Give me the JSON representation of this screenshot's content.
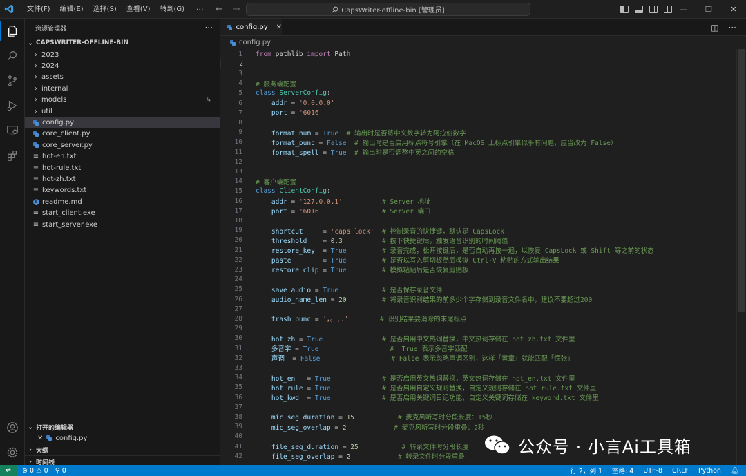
{
  "titlebar": {
    "menus": [
      "文件(F)",
      "编辑(E)",
      "选择(S)",
      "查看(V)",
      "转到(G)"
    ],
    "more": "···",
    "search_text": "CapsWriter-offline-bin [管理员]"
  },
  "sidebar": {
    "title": "资源管理器",
    "more": "···",
    "folder": "CAPSWRITER-OFFLINE-BIN",
    "items": [
      {
        "label": "2023",
        "kind": "folder"
      },
      {
        "label": "2024",
        "kind": "folder"
      },
      {
        "label": "assets",
        "kind": "folder"
      },
      {
        "label": "internal",
        "kind": "folder"
      },
      {
        "label": "models",
        "kind": "folder"
      },
      {
        "label": "util",
        "kind": "folder"
      },
      {
        "label": "config.py",
        "kind": "py"
      },
      {
        "label": "core_client.py",
        "kind": "py"
      },
      {
        "label": "core_server.py",
        "kind": "py"
      },
      {
        "label": "hot-en.txt",
        "kind": "txt"
      },
      {
        "label": "hot-rule.txt",
        "kind": "txt"
      },
      {
        "label": "hot-zh.txt",
        "kind": "txt"
      },
      {
        "label": "keywords.txt",
        "kind": "txt"
      },
      {
        "label": "readme.md",
        "kind": "md"
      },
      {
        "label": "start_client.exe",
        "kind": "txt"
      },
      {
        "label": "start_server.exe",
        "kind": "txt"
      }
    ],
    "open_editors_title": "打开的编辑器",
    "open_editors": [
      "config.py"
    ],
    "outline_title": "大纲",
    "timeline_title": "时间线"
  },
  "editor": {
    "tab_label": "config.py",
    "breadcrumb": "config.py",
    "current_line": 2
  },
  "code_lines": [
    [
      [
        "kw",
        "from"
      ],
      [
        "plain",
        " pathlib "
      ],
      [
        "kw",
        "import"
      ],
      [
        "plain",
        " Path"
      ]
    ],
    [],
    [],
    [
      [
        "cm",
        "# 服务端配置"
      ]
    ],
    [
      [
        "kw2",
        "class"
      ],
      [
        "plain",
        " "
      ],
      [
        "cls",
        "ServerConfig"
      ],
      [
        "plain",
        ":"
      ]
    ],
    [
      [
        "plain",
        "    "
      ],
      [
        "id",
        "addr"
      ],
      [
        "plain",
        " = "
      ],
      [
        "str",
        "'0.0.0.0'"
      ]
    ],
    [
      [
        "plain",
        "    "
      ],
      [
        "id",
        "port"
      ],
      [
        "plain",
        " = "
      ],
      [
        "str",
        "'6016'"
      ]
    ],
    [],
    [
      [
        "plain",
        "    "
      ],
      [
        "id",
        "format_num"
      ],
      [
        "plain",
        " = "
      ],
      [
        "kw2",
        "True"
      ],
      [
        "plain",
        "  "
      ],
      [
        "cm",
        "# 输出时是否将中文数字转为阿拉伯数字"
      ]
    ],
    [
      [
        "plain",
        "    "
      ],
      [
        "id",
        "format_punc"
      ],
      [
        "plain",
        " = "
      ],
      [
        "kw2",
        "False"
      ],
      [
        "plain",
        "  "
      ],
      [
        "cm",
        "# 输出时是否启用标点符号引擎（在 MacOS 上标点引擎似乎有问题，应当改为 False）"
      ]
    ],
    [
      [
        "plain",
        "    "
      ],
      [
        "id",
        "format_spell"
      ],
      [
        "plain",
        " = "
      ],
      [
        "kw2",
        "True"
      ],
      [
        "plain",
        "  "
      ],
      [
        "cm",
        "# 输出时是否调整中英之间的空格"
      ]
    ],
    [],
    [],
    [
      [
        "cm",
        "# 客户端配置"
      ]
    ],
    [
      [
        "kw2",
        "class"
      ],
      [
        "plain",
        " "
      ],
      [
        "cls",
        "ClientConfig"
      ],
      [
        "plain",
        ":"
      ]
    ],
    [
      [
        "plain",
        "    "
      ],
      [
        "id",
        "addr"
      ],
      [
        "plain",
        " = "
      ],
      [
        "str",
        "'127.0.0.1'"
      ],
      [
        "plain",
        "          "
      ],
      [
        "cm",
        "# Server 地址"
      ]
    ],
    [
      [
        "plain",
        "    "
      ],
      [
        "id",
        "port"
      ],
      [
        "plain",
        " = "
      ],
      [
        "str",
        "'6016'"
      ],
      [
        "plain",
        "               "
      ],
      [
        "cm",
        "# Server 端口"
      ]
    ],
    [],
    [
      [
        "plain",
        "    "
      ],
      [
        "id",
        "shortcut"
      ],
      [
        "plain",
        "     = "
      ],
      [
        "str",
        "'caps lock'"
      ],
      [
        "plain",
        "  "
      ],
      [
        "cm",
        "# 控制录音的快捷键，默认是 CapsLock"
      ]
    ],
    [
      [
        "plain",
        "    "
      ],
      [
        "id",
        "threshold"
      ],
      [
        "plain",
        "    = "
      ],
      [
        "num",
        "0.3"
      ],
      [
        "plain",
        "          "
      ],
      [
        "cm",
        "# 按下快捷键后，触发语音识别的时间阈值"
      ]
    ],
    [
      [
        "plain",
        "    "
      ],
      [
        "id",
        "restore_key"
      ],
      [
        "plain",
        "  = "
      ],
      [
        "kw2",
        "True"
      ],
      [
        "plain",
        "         "
      ],
      [
        "cm",
        "# 录音完成，松开按键后，是否自动再按一遍，以恢复 CapsLock 或 Shift 等之前的状态"
      ]
    ],
    [
      [
        "plain",
        "    "
      ],
      [
        "id",
        "paste"
      ],
      [
        "plain",
        "        = "
      ],
      [
        "kw2",
        "True"
      ],
      [
        "plain",
        "         "
      ],
      [
        "cm",
        "# 是否以写入剪切板然后模拟 Ctrl-V 粘贴的方式输出结果"
      ]
    ],
    [
      [
        "plain",
        "    "
      ],
      [
        "id",
        "restore_clip"
      ],
      [
        "plain",
        " = "
      ],
      [
        "kw2",
        "True"
      ],
      [
        "plain",
        "         "
      ],
      [
        "cm",
        "# 模拟粘贴后是否恢复剪贴板"
      ]
    ],
    [],
    [
      [
        "plain",
        "    "
      ],
      [
        "id",
        "save_audio"
      ],
      [
        "plain",
        " = "
      ],
      [
        "kw2",
        "True"
      ],
      [
        "plain",
        "           "
      ],
      [
        "cm",
        "# 是否保存录音文件"
      ]
    ],
    [
      [
        "plain",
        "    "
      ],
      [
        "id",
        "audio_name_len"
      ],
      [
        "plain",
        " = "
      ],
      [
        "num",
        "20"
      ],
      [
        "plain",
        "         "
      ],
      [
        "cm",
        "# 将录音识别结果的前多少个字存储到录音文件名中，建议不要超过200"
      ]
    ],
    [],
    [
      [
        "plain",
        "    "
      ],
      [
        "id",
        "trash_punc"
      ],
      [
        "plain",
        " = "
      ],
      [
        "str",
        "'，。,.'"
      ],
      [
        "plain",
        "        "
      ],
      [
        "cm",
        "# 识别结果要消除的末尾标点"
      ]
    ],
    [],
    [
      [
        "plain",
        "    "
      ],
      [
        "id",
        "hot_zh"
      ],
      [
        "plain",
        " = "
      ],
      [
        "kw2",
        "True"
      ],
      [
        "plain",
        "               "
      ],
      [
        "cm",
        "# 是否启用中文热词替换，中文热词存储在 hot_zh.txt 文件里"
      ]
    ],
    [
      [
        "plain",
        "    "
      ],
      [
        "id",
        "多音字"
      ],
      [
        "plain",
        " = "
      ],
      [
        "kw2",
        "True"
      ],
      [
        "plain",
        "                  "
      ],
      [
        "cm",
        "#  True 表示多音字匹配"
      ]
    ],
    [
      [
        "plain",
        "    "
      ],
      [
        "id",
        "声调"
      ],
      [
        "plain",
        "  = "
      ],
      [
        "kw2",
        "False"
      ],
      [
        "plain",
        "                  "
      ],
      [
        "cm",
        "# False 表示忽略声调区别，这样「黄章」就能匹配「慌张」"
      ]
    ],
    [],
    [
      [
        "plain",
        "    "
      ],
      [
        "id",
        "hot_en"
      ],
      [
        "plain",
        "   = "
      ],
      [
        "kw2",
        "True"
      ],
      [
        "plain",
        "             "
      ],
      [
        "cm",
        "# 是否启用英文热词替换，英文热词存储在 hot_en.txt 文件里"
      ]
    ],
    [
      [
        "plain",
        "    "
      ],
      [
        "id",
        "hot_rule"
      ],
      [
        "plain",
        " = "
      ],
      [
        "kw2",
        "True"
      ],
      [
        "plain",
        "             "
      ],
      [
        "cm",
        "# 是否启用自定义规则替换，自定义规则存储在 hot_rule.txt 文件里"
      ]
    ],
    [
      [
        "plain",
        "    "
      ],
      [
        "id",
        "hot_kwd"
      ],
      [
        "plain",
        "  = "
      ],
      [
        "kw2",
        "True"
      ],
      [
        "plain",
        "             "
      ],
      [
        "cm",
        "# 是否启用关键词日记功能，自定义关键词存储在 keyword.txt 文件里"
      ]
    ],
    [],
    [
      [
        "plain",
        "    "
      ],
      [
        "id",
        "mic_seg_duration"
      ],
      [
        "plain",
        " = "
      ],
      [
        "num",
        "15"
      ],
      [
        "plain",
        "           "
      ],
      [
        "cm",
        "# 麦克风听写时分段长度：15秒"
      ]
    ],
    [
      [
        "plain",
        "    "
      ],
      [
        "id",
        "mic_seg_overlap"
      ],
      [
        "plain",
        " = "
      ],
      [
        "num",
        "2"
      ],
      [
        "plain",
        "            "
      ],
      [
        "cm",
        "# 麦克风听写时分段重叠：2秒"
      ]
    ],
    [],
    [
      [
        "plain",
        "    "
      ],
      [
        "id",
        "file_seg_duration"
      ],
      [
        "plain",
        " = "
      ],
      [
        "num",
        "25"
      ],
      [
        "plain",
        "           "
      ],
      [
        "cm",
        "# 转录文件时分段长度"
      ]
    ],
    [
      [
        "plain",
        "    "
      ],
      [
        "id",
        "file_seg_overlap"
      ],
      [
        "plain",
        " = "
      ],
      [
        "num",
        "2"
      ],
      [
        "plain",
        "            "
      ],
      [
        "cm",
        "# 转录文件时分段重叠"
      ]
    ]
  ],
  "watermark": {
    "text": "公众号 · 小言Ai工具箱"
  },
  "statusbar": {
    "errors": "0",
    "warnings": "0",
    "ports": "0",
    "position": "行 2，列 1",
    "spaces": "空格: 4",
    "encoding": "UTF-8",
    "eol": "CRLF",
    "language": "Python"
  },
  "colors": {
    "accent": "#0078d4",
    "statusbar": "#007acc",
    "keyword": "#c586c0",
    "class": "#4ec9b0",
    "string": "#ce9178",
    "comment": "#6a9955"
  }
}
